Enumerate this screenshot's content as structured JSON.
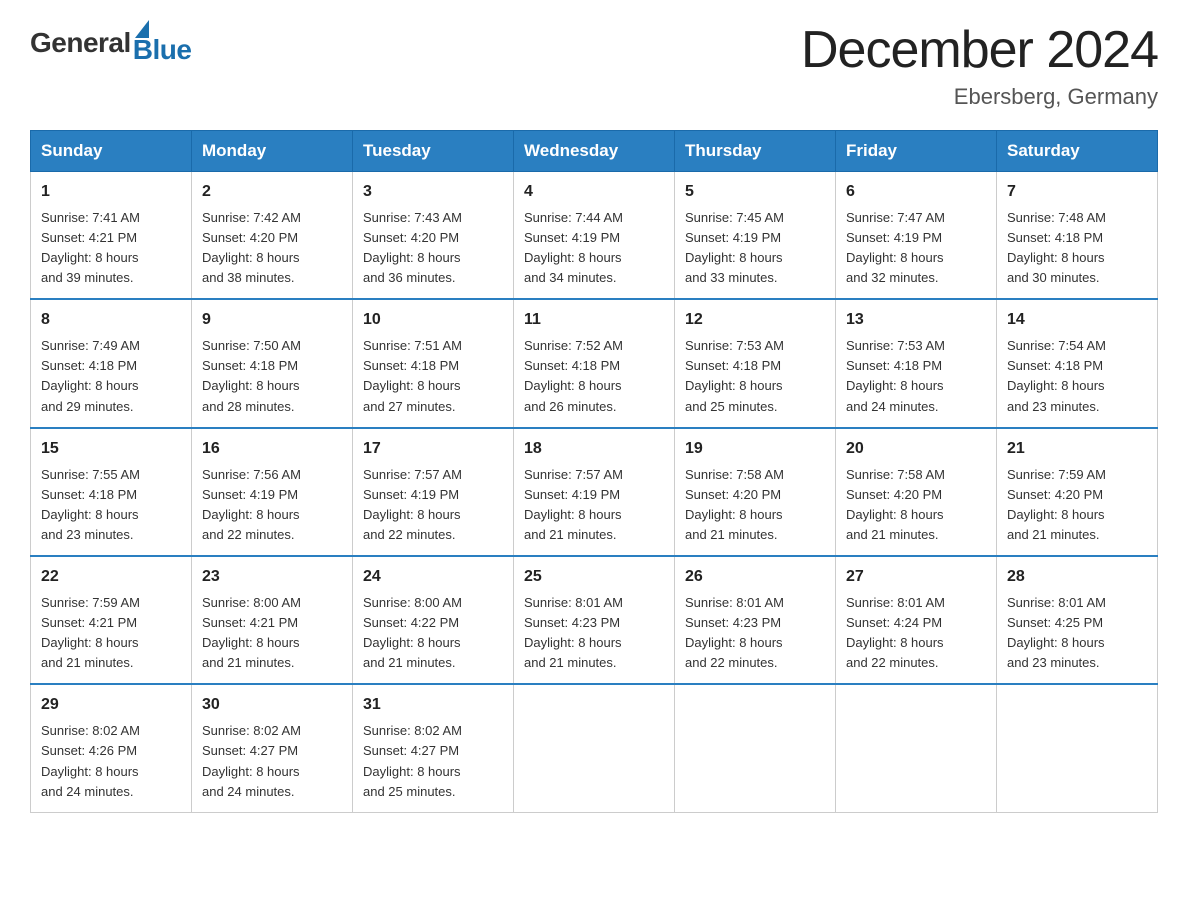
{
  "logo": {
    "general": "General",
    "blue": "Blue"
  },
  "title": "December 2024",
  "location": "Ebersberg, Germany",
  "days_header": [
    "Sunday",
    "Monday",
    "Tuesday",
    "Wednesday",
    "Thursday",
    "Friday",
    "Saturday"
  ],
  "weeks": [
    [
      {
        "day": "1",
        "sunrise": "7:41 AM",
        "sunset": "4:21 PM",
        "daylight": "8 hours and 39 minutes."
      },
      {
        "day": "2",
        "sunrise": "7:42 AM",
        "sunset": "4:20 PM",
        "daylight": "8 hours and 38 minutes."
      },
      {
        "day": "3",
        "sunrise": "7:43 AM",
        "sunset": "4:20 PM",
        "daylight": "8 hours and 36 minutes."
      },
      {
        "day": "4",
        "sunrise": "7:44 AM",
        "sunset": "4:19 PM",
        "daylight": "8 hours and 34 minutes."
      },
      {
        "day": "5",
        "sunrise": "7:45 AM",
        "sunset": "4:19 PM",
        "daylight": "8 hours and 33 minutes."
      },
      {
        "day": "6",
        "sunrise": "7:47 AM",
        "sunset": "4:19 PM",
        "daylight": "8 hours and 32 minutes."
      },
      {
        "day": "7",
        "sunrise": "7:48 AM",
        "sunset": "4:18 PM",
        "daylight": "8 hours and 30 minutes."
      }
    ],
    [
      {
        "day": "8",
        "sunrise": "7:49 AM",
        "sunset": "4:18 PM",
        "daylight": "8 hours and 29 minutes."
      },
      {
        "day": "9",
        "sunrise": "7:50 AM",
        "sunset": "4:18 PM",
        "daylight": "8 hours and 28 minutes."
      },
      {
        "day": "10",
        "sunrise": "7:51 AM",
        "sunset": "4:18 PM",
        "daylight": "8 hours and 27 minutes."
      },
      {
        "day": "11",
        "sunrise": "7:52 AM",
        "sunset": "4:18 PM",
        "daylight": "8 hours and 26 minutes."
      },
      {
        "day": "12",
        "sunrise": "7:53 AM",
        "sunset": "4:18 PM",
        "daylight": "8 hours and 25 minutes."
      },
      {
        "day": "13",
        "sunrise": "7:53 AM",
        "sunset": "4:18 PM",
        "daylight": "8 hours and 24 minutes."
      },
      {
        "day": "14",
        "sunrise": "7:54 AM",
        "sunset": "4:18 PM",
        "daylight": "8 hours and 23 minutes."
      }
    ],
    [
      {
        "day": "15",
        "sunrise": "7:55 AM",
        "sunset": "4:18 PM",
        "daylight": "8 hours and 23 minutes."
      },
      {
        "day": "16",
        "sunrise": "7:56 AM",
        "sunset": "4:19 PM",
        "daylight": "8 hours and 22 minutes."
      },
      {
        "day": "17",
        "sunrise": "7:57 AM",
        "sunset": "4:19 PM",
        "daylight": "8 hours and 22 minutes."
      },
      {
        "day": "18",
        "sunrise": "7:57 AM",
        "sunset": "4:19 PM",
        "daylight": "8 hours and 21 minutes."
      },
      {
        "day": "19",
        "sunrise": "7:58 AM",
        "sunset": "4:20 PM",
        "daylight": "8 hours and 21 minutes."
      },
      {
        "day": "20",
        "sunrise": "7:58 AM",
        "sunset": "4:20 PM",
        "daylight": "8 hours and 21 minutes."
      },
      {
        "day": "21",
        "sunrise": "7:59 AM",
        "sunset": "4:20 PM",
        "daylight": "8 hours and 21 minutes."
      }
    ],
    [
      {
        "day": "22",
        "sunrise": "7:59 AM",
        "sunset": "4:21 PM",
        "daylight": "8 hours and 21 minutes."
      },
      {
        "day": "23",
        "sunrise": "8:00 AM",
        "sunset": "4:21 PM",
        "daylight": "8 hours and 21 minutes."
      },
      {
        "day": "24",
        "sunrise": "8:00 AM",
        "sunset": "4:22 PM",
        "daylight": "8 hours and 21 minutes."
      },
      {
        "day": "25",
        "sunrise": "8:01 AM",
        "sunset": "4:23 PM",
        "daylight": "8 hours and 21 minutes."
      },
      {
        "day": "26",
        "sunrise": "8:01 AM",
        "sunset": "4:23 PM",
        "daylight": "8 hours and 22 minutes."
      },
      {
        "day": "27",
        "sunrise": "8:01 AM",
        "sunset": "4:24 PM",
        "daylight": "8 hours and 22 minutes."
      },
      {
        "day": "28",
        "sunrise": "8:01 AM",
        "sunset": "4:25 PM",
        "daylight": "8 hours and 23 minutes."
      }
    ],
    [
      {
        "day": "29",
        "sunrise": "8:02 AM",
        "sunset": "4:26 PM",
        "daylight": "8 hours and 24 minutes."
      },
      {
        "day": "30",
        "sunrise": "8:02 AM",
        "sunset": "4:27 PM",
        "daylight": "8 hours and 24 minutes."
      },
      {
        "day": "31",
        "sunrise": "8:02 AM",
        "sunset": "4:27 PM",
        "daylight": "8 hours and 25 minutes."
      },
      null,
      null,
      null,
      null
    ]
  ],
  "labels": {
    "sunrise": "Sunrise:",
    "sunset": "Sunset:",
    "daylight": "Daylight:"
  }
}
